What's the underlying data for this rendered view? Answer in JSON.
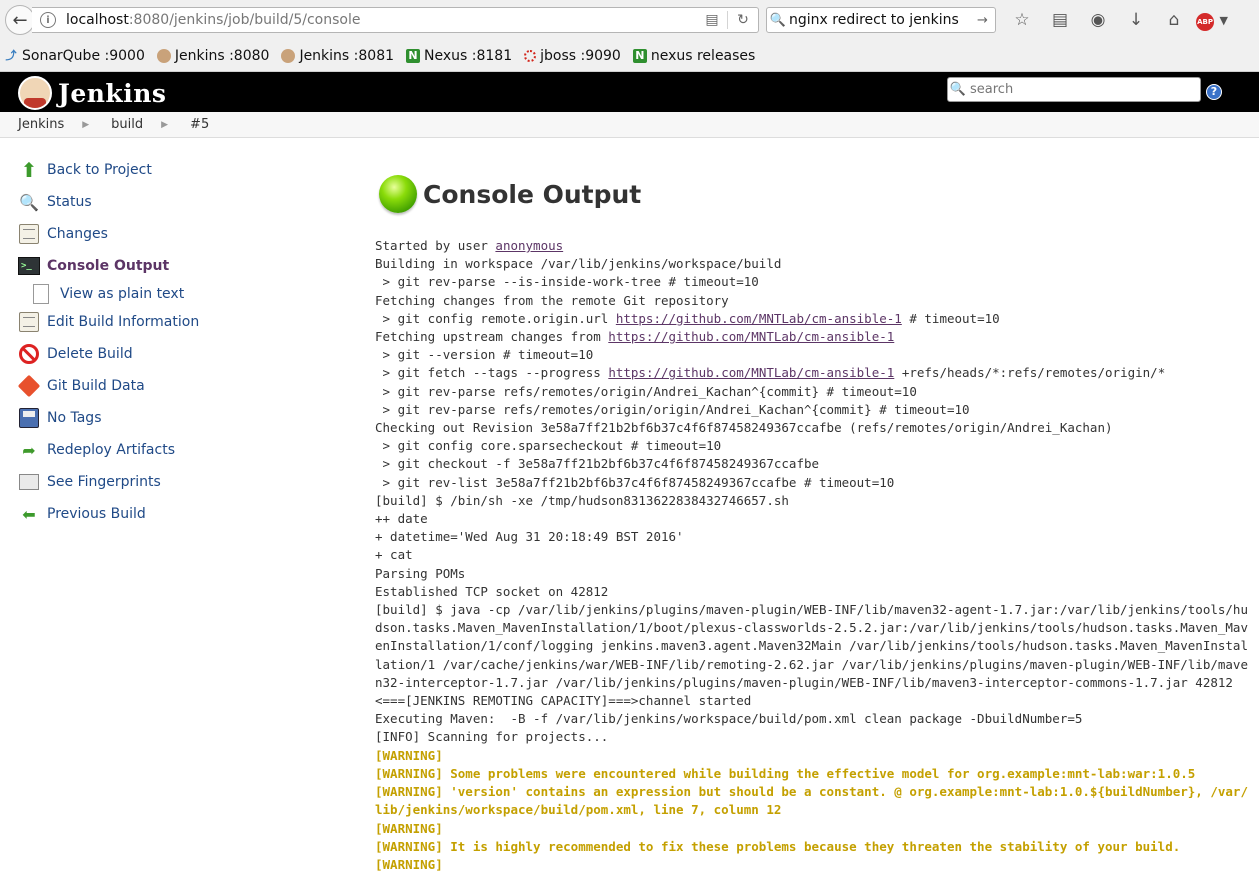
{
  "browser": {
    "url_host": "localhost",
    "url_path": ":8080/jenkins/job/build/5/console",
    "search_value": "nginx redirect to jenkins"
  },
  "bookmarks": [
    {
      "label": "SonarQube :9000",
      "icon": "sonarqube-icon"
    },
    {
      "label": "Jenkins :8080",
      "icon": "jenkins-icon"
    },
    {
      "label": "Jenkins :8081",
      "icon": "jenkins-icon"
    },
    {
      "label": "Nexus :8181",
      "icon": "nexus-icon"
    },
    {
      "label": "jboss :9090",
      "icon": "jboss-icon"
    },
    {
      "label": "nexus releases",
      "icon": "nexus-icon"
    }
  ],
  "header": {
    "title": "Jenkins",
    "search_placeholder": "search",
    "help": "?"
  },
  "breadcrumb": [
    "Jenkins",
    "build",
    "#5"
  ],
  "sidebar": {
    "items": [
      {
        "label": "Back to Project",
        "icon": "arrow-up-icon"
      },
      {
        "label": "Status",
        "icon": "magnifier-icon"
      },
      {
        "label": "Changes",
        "icon": "notepad-icon"
      },
      {
        "label": "Console Output",
        "icon": "terminal-icon"
      },
      {
        "label": "View as plain text",
        "icon": "document-icon"
      },
      {
        "label": "Edit Build Information",
        "icon": "notepad-icon"
      },
      {
        "label": "Delete Build",
        "icon": "delete-icon"
      },
      {
        "label": "Git Build Data",
        "icon": "git-icon"
      },
      {
        "label": "No Tags",
        "icon": "save-icon"
      },
      {
        "label": "Redeploy Artifacts",
        "icon": "redeploy-icon"
      },
      {
        "label": "See Fingerprints",
        "icon": "fingerprint-icon"
      },
      {
        "label": "Previous Build",
        "icon": "arrow-left-icon"
      }
    ]
  },
  "main": {
    "title": "Console Output",
    "status_color": "#4caf00",
    "console": {
      "started_prefix": "Started by user ",
      "started_user": "anonymous",
      "l_workspace": "Building in workspace /var/lib/jenkins/workspace/build",
      "l_revparse": " > git rev-parse --is-inside-work-tree # timeout=10",
      "l_fetching": "Fetching changes from the remote Git repository",
      "l_config_prefix": " > git config remote.origin.url ",
      "repo_url": "https://github.com/MNTLab/cm-ansible-1",
      "l_config_suffix": " # timeout=10",
      "l_upstream_prefix": "Fetching upstream changes from ",
      "l_version": " > git --version # timeout=10",
      "l_fetch_prefix": " > git fetch --tags --progress ",
      "l_fetch_suffix": " +refs/heads/*:refs/remotes/origin/*",
      "l_rev1": " > git rev-parse refs/remotes/origin/Andrei_Kachan^{commit} # timeout=10",
      "l_rev2": " > git rev-parse refs/remotes/origin/origin/Andrei_Kachan^{commit} # timeout=10",
      "l_checkout_rev": "Checking out Revision 3e58a7ff21b2bf6b37c4f6f87458249367ccafbe (refs/remotes/origin/Andrei_Kachan)",
      "l_sparse": " > git config core.sparsecheckout # timeout=10",
      "l_checkout": " > git checkout -f 3e58a7ff21b2bf6b37c4f6f87458249367ccafbe",
      "l_revlist": " > git rev-list 3e58a7ff21b2bf6b37c4f6f87458249367ccafbe # timeout=10",
      "l_sh": "[build] $ /bin/sh -xe /tmp/hudson8313622838432746657.sh",
      "l_date": "++ date",
      "l_datetime": "+ datetime='Wed Aug 31 20:18:49 BST 2016'",
      "l_cat": "+ cat",
      "l_poms": "Parsing POMs",
      "l_tcp": "Established TCP socket on 42812",
      "l_java": "[build] $ java -cp /var/lib/jenkins/plugins/maven-plugin/WEB-INF/lib/maven32-agent-1.7.jar:/var/lib/jenkins/tools/hudson.tasks.Maven_MavenInstallation/1/boot/plexus-classworlds-2.5.2.jar:/var/lib/jenkins/tools/hudson.tasks.Maven_MavenInstallation/1/conf/logging jenkins.maven3.agent.Maven32Main /var/lib/jenkins/tools/hudson.tasks.Maven_MavenInstallation/1 /var/cache/jenkins/war/WEB-INF/lib/remoting-2.62.jar /var/lib/jenkins/plugins/maven-plugin/WEB-INF/lib/maven32-interceptor-1.7.jar /var/lib/jenkins/plugins/maven-plugin/WEB-INF/lib/maven3-interceptor-commons-1.7.jar 42812",
      "l_remoting": "<===[JENKINS REMOTING CAPACITY]===>channel started",
      "l_exec": "Executing Maven:  -B -f /var/lib/jenkins/workspace/build/pom.xml clean package -DbuildNumber=5",
      "l_scan": "[INFO] Scanning for projects...",
      "w1": "[WARNING]",
      "w2": "[WARNING] Some problems were encountered while building the effective model for org.example:mnt-lab:war:1.0.5",
      "w3": "[WARNING] 'version' contains an expression but should be a constant. @ org.example:mnt-lab:1.0.${buildNumber}, /var/lib/jenkins/workspace/build/pom.xml, line 7, column 12",
      "w4": "[WARNING]",
      "w5": "[WARNING] It is highly recommended to fix these problems because they threaten the stability of your build.",
      "w6": "[WARNING]"
    }
  }
}
